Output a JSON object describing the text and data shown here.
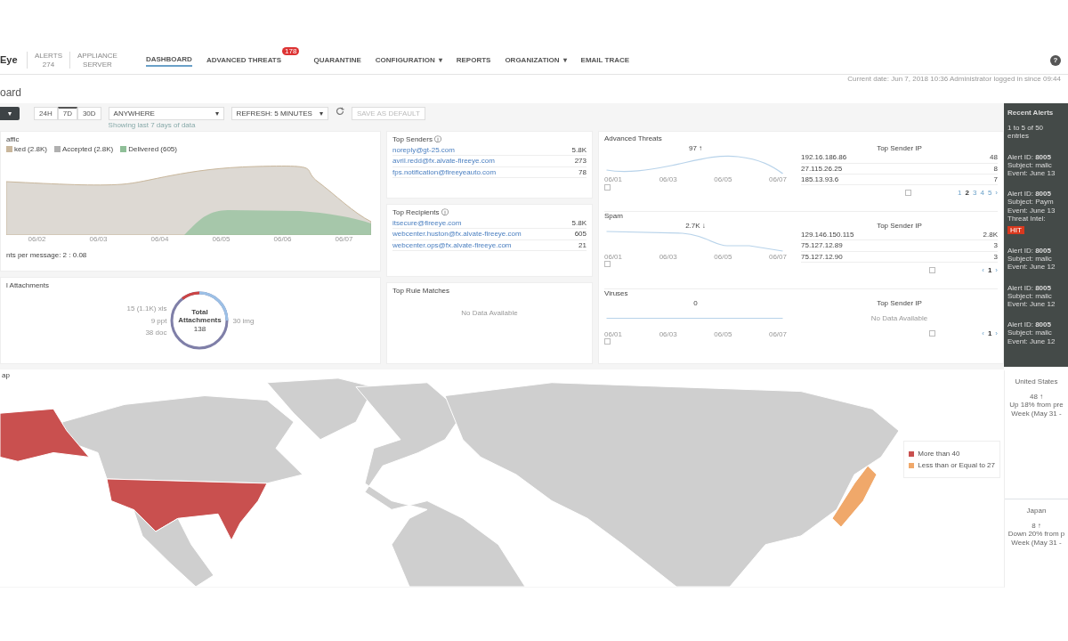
{
  "header": {
    "logo": "Eye",
    "stats": [
      {
        "label": "ALERTS",
        "value": "274"
      },
      {
        "label": "APPLIANCE",
        "value": "SERVER"
      }
    ],
    "nav": [
      {
        "label": "DASHBOARD",
        "selected": true
      },
      {
        "label": "ADVANCED THREATS",
        "selected": false,
        "badge": "178"
      },
      {
        "label": "QUARANTINE",
        "selected": false
      },
      {
        "label": "CONFIGURATION",
        "selected": false,
        "caret": "▾"
      },
      {
        "label": "REPORTS",
        "selected": false
      },
      {
        "label": "ORGANIZATION",
        "selected": false,
        "caret": "▾"
      },
      {
        "label": "EMAIL TRACE",
        "selected": false
      }
    ],
    "help": "?",
    "status_text": "Current date: Jun 7, 2018 10:36 Administrator logged in since 09:44"
  },
  "page_title": "oard",
  "toolbar": {
    "menu_button": "▾",
    "ranges": [
      {
        "label": "24H",
        "selected": false
      },
      {
        "label": "7D",
        "selected": true
      },
      {
        "label": "30D",
        "selected": false
      }
    ],
    "location": {
      "value": "ANYWHERE",
      "caret": "▾"
    },
    "refresh": {
      "value": "REFRESH: 5 MINUTES",
      "caret": "▾"
    },
    "save": {
      "label": "SAVE AS DEFAULT",
      "disabled": true
    },
    "hint": "Showing last 7 days of data"
  },
  "traffic": {
    "title": "affic",
    "legend": [
      {
        "label": "ked (2.8K)",
        "checked": true,
        "color": "#c9b79c"
      },
      {
        "label": "Accepted (2.8K)",
        "checked": true,
        "color": "#b0b0b0"
      },
      {
        "label": "Delivered (605)",
        "checked": true,
        "color": "#8fbf98"
      }
    ],
    "x_labels": [
      "06/02",
      "06/03",
      "06/04",
      "06/05",
      "06/06",
      "06/07"
    ],
    "footer": "nts per message: 2 : 0.08"
  },
  "attachments": {
    "title": "l Attachments",
    "labels": [
      {
        "text": "15 (1.1K) xls"
      },
      {
        "text": "9 ppt"
      },
      {
        "text": "38 doc"
      },
      {
        "text": "30 img"
      }
    ],
    "center_title": "Total Attachments",
    "center_value": "138"
  },
  "top_senders": {
    "title": "Top Senders ⓘ",
    "rows": [
      {
        "name": "noreply@gt-25.com",
        "count": "5.8K"
      },
      {
        "name": "avril.redd@fx.alvate-fireeye.com",
        "count": "273"
      },
      {
        "name": "fps.notification@fireeyeauto.com",
        "count": "78"
      }
    ]
  },
  "top_recipients": {
    "title": "Top Recipients ⓘ",
    "rows": [
      {
        "name": "itsecure@fireeye.com",
        "count": "5.8K"
      },
      {
        "name": "webcenter.huston@fx.alvate-fireeye.com",
        "count": "605"
      },
      {
        "name": "webcenter.ops@fx.alvate-fireeye.com",
        "count": "21"
      }
    ]
  },
  "top_rules": {
    "title": "Top Rule Matches",
    "empty": "No Data Available"
  },
  "metrics": [
    {
      "title": "Advanced Threats",
      "value": "97 ↑",
      "x_labels": [
        "06/01",
        "06/03",
        "06/05",
        "06/07"
      ],
      "table_title": "Top Sender IP",
      "rows": [
        {
          "ip": "192.16.186.86",
          "count": "48"
        },
        {
          "ip": "27.115.26.25",
          "count": "8"
        },
        {
          "ip": "185.13.93.6",
          "count": "7"
        }
      ],
      "pages": [
        {
          "label": "1",
          "selected": false
        },
        {
          "label": "2",
          "selected": true
        },
        {
          "label": "3",
          "selected": false
        },
        {
          "label": "4",
          "selected": false
        },
        {
          "label": "5",
          "selected": false
        },
        {
          "label": "›",
          "selected": false
        }
      ]
    },
    {
      "title": "Spam",
      "value": "2.7K ↓",
      "x_labels": [
        "06/01",
        "06/03",
        "06/05",
        "06/07"
      ],
      "table_title": "Top Sender IP",
      "rows": [
        {
          "ip": "129.146.150.115",
          "count": "2.8K"
        },
        {
          "ip": "75.127.12.89",
          "count": "3"
        },
        {
          "ip": "75.127.12.90",
          "count": "3"
        }
      ],
      "pages": [
        {
          "label": "‹",
          "selected": false
        },
        {
          "label": "1",
          "selected": true
        },
        {
          "label": "›",
          "selected": false
        }
      ]
    },
    {
      "title": "Viruses",
      "value": "0",
      "x_labels": [
        "06/01",
        "06/03",
        "06/05",
        "06/07"
      ],
      "table_title": "Top Sender IP",
      "empty": "No Data Available",
      "pages": [
        {
          "label": "‹",
          "selected": false
        },
        {
          "label": "1",
          "selected": true
        },
        {
          "label": "›",
          "selected": false
        }
      ]
    }
  ],
  "recent_alerts": {
    "title": "Recent Alerts",
    "count": "1 to 5 of 50 entries",
    "alerts": [
      {
        "id": "Alert ID: **8005**",
        "subject": "Subject: malic",
        "event": "Event: June 13"
      },
      {
        "id": "Alert ID: **8005**",
        "subject": "Subject: Paym",
        "event": "Event: June 13",
        "threat_intel": "Threat Intel:",
        "hit": "HIT"
      },
      {
        "id": "Alert ID: **8005**",
        "subject": "Subject: malic",
        "event": "Event: June 12"
      },
      {
        "id": "Alert ID: **8005**",
        "subject": "Subject: malic",
        "event": "Event: June 12"
      },
      {
        "id": "Alert ID: **8005**",
        "subject": "Subject: malic",
        "event": "Event: June 12"
      }
    ]
  },
  "map": {
    "title": "ap",
    "legend": [
      {
        "label": "More than 40",
        "color": "#c9504f"
      },
      {
        "label": "Less than or Equal to 27",
        "color": "#f0a86a"
      }
    ]
  },
  "countries": [
    {
      "name": "United States",
      "value": "48 ↑",
      "change": "Up 18% from pre",
      "period": "Week (May 31 -"
    },
    {
      "name": "Japan",
      "value": "8 ↑",
      "change": "Down 20% from p",
      "period": "Week (May 31 -"
    }
  ]
}
